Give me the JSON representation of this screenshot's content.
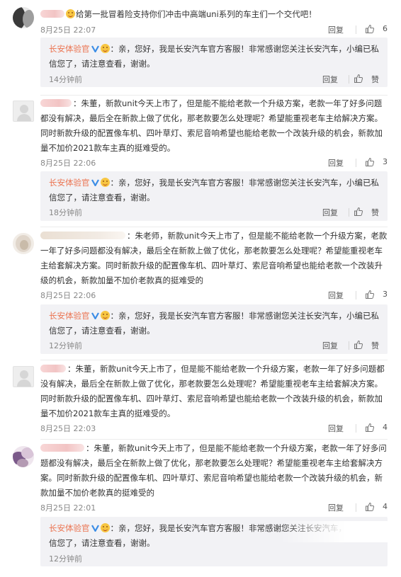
{
  "labels": {
    "reply": "回复",
    "like": "赞"
  },
  "comments": [
    {
      "text": "给第一批冒着险支持你们冲击中高端uni系列的车主们一个交代吧！",
      "time": "8月25日 22:07",
      "likes": "6",
      "reply": {
        "name": "长安体验官",
        "text": "：亲，您好，我是长安汽车官方客服！非常感谢您关注长安汽车，小编已私信您了，请注意查看，谢谢。",
        "time": "14分钟前"
      }
    },
    {
      "text": "：朱董，新款unit今天上市了，但是能不能给老款一个升级方案，老款一年了好多问题都没有解决，最后全在新款上做了优化，那老款要怎么处理呢？希望能重视老车主给解决方案。同时新款升级的配置像车机、四叶草灯、索尼音响希望也能给老款一个改装升级的机会，新款加量不加价2021款车主真的挺难受的。",
      "time": "8月25日 22:06",
      "likes": "3",
      "reply": {
        "name": "长安体验官",
        "text": "：亲，您好，我是长安汽车官方客服！非常感谢您关注长安汽车，小编已私信您了，请注意查看，谢谢。",
        "time": "18分钟前"
      }
    },
    {
      "text": "：朱老师，新款unit今天上市了，但是能不能给老款一个升级方案，老款一年了好多问题都没有解决，最后全在新款上做了优化，那老款要怎么处理呢？希望能重视老车主给套解决方案。同时新款升级的配置像车机、四叶草灯、索尼音响希望也能给老款一个改装升级的机会，新款加量不加价老款真的挺难受的",
      "time": "8月25日 22:06",
      "likes": "3",
      "reply": {
        "name": "长安体验官",
        "text": "：亲，您好，我是长安汽车官方客服！非常感谢您关注长安汽车，小编已私信您了，请注意查看，谢谢。",
        "time": "12分钟前"
      }
    },
    {
      "text": "：朱董，新款unit今天上市了，但是能不能给老款一个升级方案，老款一年了好多问题都没有解决，最后全在新款上做了优化，那老款要怎么处理呢？希望能重视老车主给套解决方案。同时新款升级的配置像车机、四叶草灯、索尼音响希望也能给老款一个改装升级的机会，新款加量不加价2021款车主真的挺难受的。",
      "time": "8月25日 22:03",
      "likes": "4"
    },
    {
      "text": "：朱董，新款unit今天上市了，但是能不能给老款一个升级方案，老款一年了好多问题都没有解决，最后全在新款上做了优化，那老款要怎么处理呢？希望能重视老车主给套解决方案。同时新款升级的配置像车机、四叶草灯、索尼音响希望也能给老款一个改装升级的机会，新款加量不加价老款真的挺难受的",
      "time": "8月25日 22:01",
      "likes": "4",
      "reply": {
        "name": "长安体验官",
        "text": "：亲，您好，我是长安汽车官方客服！非常感谢您关注长安汽车，小编已私信您了，请注意查看，谢谢。",
        "time": "12分钟前"
      }
    }
  ],
  "colors": {
    "accent": "#eb7350",
    "verified": "#3b8de6",
    "reply_bg": "#f2f2f5",
    "meta": "#888888"
  }
}
